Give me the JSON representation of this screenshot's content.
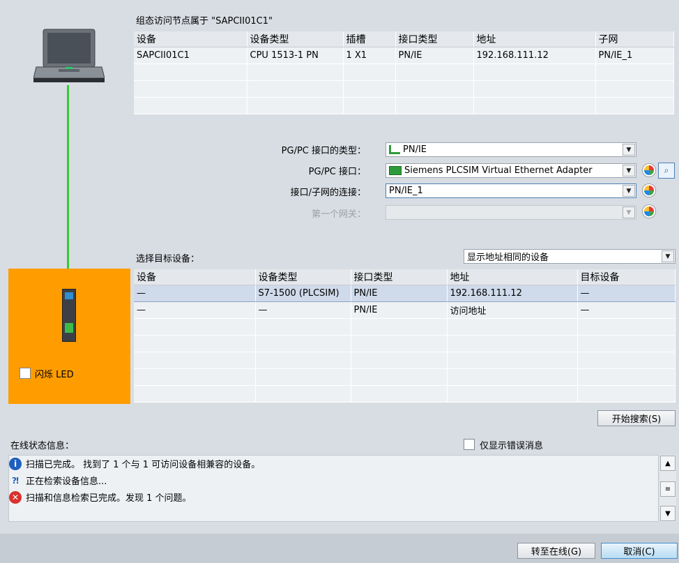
{
  "top": {
    "caption": "组态访问节点属于 \"SAPCII01C1\"",
    "headers": [
      "设备",
      "设备类型",
      "插槽",
      "接口类型",
      "地址",
      "子网"
    ],
    "rows": [
      [
        "SAPCII01C1",
        "CPU 1513-1 PN",
        "1 X1",
        "PN/IE",
        "192.168.111.12",
        "PN/IE_1"
      ]
    ]
  },
  "form": {
    "pgpc_type_label": "PG/PC 接口的类型：",
    "pgpc_type_value": "PN/IE",
    "pgpc_if_label": "PG/PC 接口：",
    "pgpc_if_value": "Siemens PLCSIM Virtual Ethernet Adapter",
    "subnet_label": "接口/子网的连接：",
    "subnet_value": "PN/IE_1",
    "gateway_label": "第一个网关："
  },
  "target": {
    "caption": "选择目标设备：",
    "filter_value": "显示地址相同的设备",
    "headers": [
      "设备",
      "设备类型",
      "接口类型",
      "地址",
      "目标设备"
    ],
    "rows": [
      [
        "—",
        "S7-1500 (PLCSIM)",
        "PN/IE",
        "192.168.111.12",
        "—"
      ],
      [
        "—",
        "—",
        "PN/IE",
        "访问地址",
        "—"
      ]
    ]
  },
  "led_label": "闪烁 LED",
  "search_button": "开始搜索(S)",
  "status": {
    "caption": "在线状态信息：",
    "errors_only_label": "仅显示错误消息",
    "messages": [
      {
        "icon": "info-icon",
        "text": "扫描已完成。 找到了 1 个与 1 可访问设备相兼容的设备。"
      },
      {
        "icon": "network-search-icon",
        "text": "正在检索设备信息..."
      },
      {
        "icon": "error-icon",
        "text": "扫描和信息检索已完成。发现 1 个问题。"
      }
    ]
  },
  "footer": {
    "go_online": "转至在线(G)",
    "cancel": "取消(C)"
  },
  "colors": {
    "accent_orange": "#ff9c00",
    "link_green": "#33cc33",
    "selected_row": "#cfdaea"
  }
}
